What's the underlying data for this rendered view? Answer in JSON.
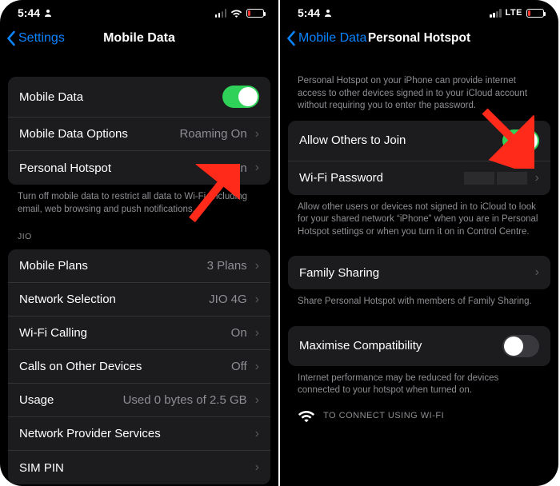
{
  "statusbar": {
    "time": "5:44"
  },
  "left": {
    "back_label": "Settings",
    "title": "Mobile Data",
    "group1": {
      "mobile_data": "Mobile Data",
      "options": "Mobile Data Options",
      "options_val": "Roaming On",
      "hotspot": "Personal Hotspot",
      "hotspot_val": "On"
    },
    "footer1": "Turn off mobile data to restrict all data to Wi-Fi, including email, web browsing and push notifications.",
    "carrier_header": "JIO",
    "group2": {
      "plans": "Mobile Plans",
      "plans_val": "3 Plans",
      "network_sel": "Network Selection",
      "network_sel_val": "JIO 4G",
      "wifi_calling": "Wi-Fi Calling",
      "wifi_calling_val": "On",
      "cod": "Calls on Other Devices",
      "cod_val": "Off",
      "usage": "Usage",
      "usage_val": "Used 0 bytes of 2.5 GB",
      "nps": "Network Provider Services",
      "simpin": "SIM PIN"
    }
  },
  "right": {
    "back_label": "Mobile Data",
    "title": "Personal Hotspot",
    "intro": "Personal Hotspot on your iPhone can provide internet access to other devices signed in to your iCloud account without requiring you to enter the password.",
    "group1": {
      "allow": "Allow Others to Join",
      "pw": "Wi-Fi Password"
    },
    "footer1": "Allow other users or devices not signed in to iCloud to look for your shared network “iPhone” when you are in Personal Hotspot settings or when you turn it on in Control Centre.",
    "group2": {
      "family": "Family Sharing"
    },
    "footer2": "Share Personal Hotspot with members of Family Sharing.",
    "group3": {
      "max": "Maximise Compatibility"
    },
    "footer3": "Internet performance may be reduced for devices connected to your hotspot when turned on.",
    "connect_header": "TO CONNECT USING WI-FI"
  }
}
